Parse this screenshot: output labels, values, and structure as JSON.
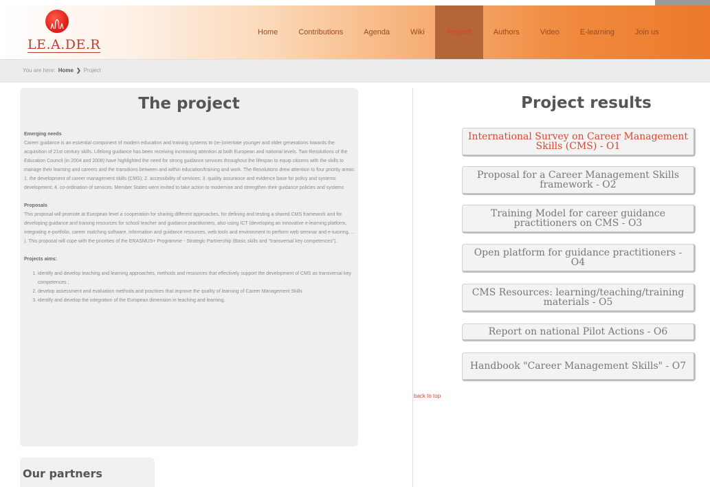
{
  "header": {
    "logo_text": "LE.A.DE.R",
    "nav": [
      {
        "label": "Home",
        "name": "nav-home",
        "active": false
      },
      {
        "label": "Contributions",
        "name": "nav-contributions",
        "active": false
      },
      {
        "label": "Agenda",
        "name": "nav-agenda",
        "active": false
      },
      {
        "label": "Wiki",
        "name": "nav-wiki",
        "active": false
      },
      {
        "label": "Project",
        "name": "nav-project",
        "active": true
      },
      {
        "label": "Authors",
        "name": "nav-authors",
        "active": false
      },
      {
        "label": "Video",
        "name": "nav-video",
        "active": false
      },
      {
        "label": "E-learning",
        "name": "nav-elearning",
        "active": false
      },
      {
        "label": "Join us",
        "name": "nav-join-us",
        "active": false
      }
    ],
    "accent": "#ec7a2a",
    "logo_color": "#e2231a"
  },
  "breadcrumb": {
    "prefix": "You are here:",
    "home": "Home",
    "current": "Project"
  },
  "left": {
    "title": "The project",
    "sections": {
      "emerging_heading": "Emerging needs",
      "emerging_body": "Career guidance is an essential component of modern education and training systems to (re-)orientate younger and older generations towards the acquisition of 21st century skills. Lifelong guidance has been receiving increasing attention at both European and national levels. Two Resolutions of the Education Council (in 2004 and 2008) have highlighted the need for strong guidance services throughout the lifespan to equip citizens with the skills to manage their learning and careers and the transitions between and within education/training and work. The Resolutions drew attention to four priority areas: 1. the development of career management skills (CMS); 2. accessibility of services; 3. quality assurance and evidence base for policy and systems development; 4. co-ordination of services. Member States were invited to take action to modernise and strengthen their guidance policies and systems",
      "proposals_heading": "Proposals",
      "proposals_body": "This proposal will promote at European level a cooperation for sharing different approaches, for defining and testing a shared CMS framework and for developing guidance and training resources for school teacher and guidance practitioners, also using ICT (developing an innovative e-learning platform, integrating e-portfolio, career matching software, information and guidance resources, web tools and environment to perform web seminar and e-tutoring, ... ). This proposal will cope with the priorities of the ERASMUS+ Programme - Strategic Partnership (Basic skills and \"transversal key competences\").",
      "aims_heading": "Projects aims:",
      "aims": [
        "identify and develop teaching and learning approaches, methods and resources that effectively support the development of CMS as transversal key competences ;",
        "develop assessment and evaluation methods and practices that improve the quality of learning of Career Management Skills",
        "identify and develop the integration of the European dimension in teaching and learning."
      ]
    },
    "back_to_top": "back to top",
    "partners_title": "Our partners"
  },
  "right": {
    "title": "Project results",
    "results": [
      {
        "label": "International Survey on Career Management Skills (CMS) - O1",
        "active": true
      },
      {
        "label": "Proposal for a Career Management Skills framework - O2",
        "active": false
      },
      {
        "label": "Training Model for career guidance practitioners on CMS - O3",
        "active": false
      },
      {
        "label": "Open platform for guidance practitioners - O4",
        "active": false
      },
      {
        "label": "CMS Resources: learning/teaching/training materials - O5",
        "active": false
      },
      {
        "label": "Report on national Pilot Actions - O6",
        "active": false
      },
      {
        "label": "Handbook \"Career Management Skills\" - O7",
        "active": false
      }
    ],
    "active_color": "#d9472b"
  }
}
